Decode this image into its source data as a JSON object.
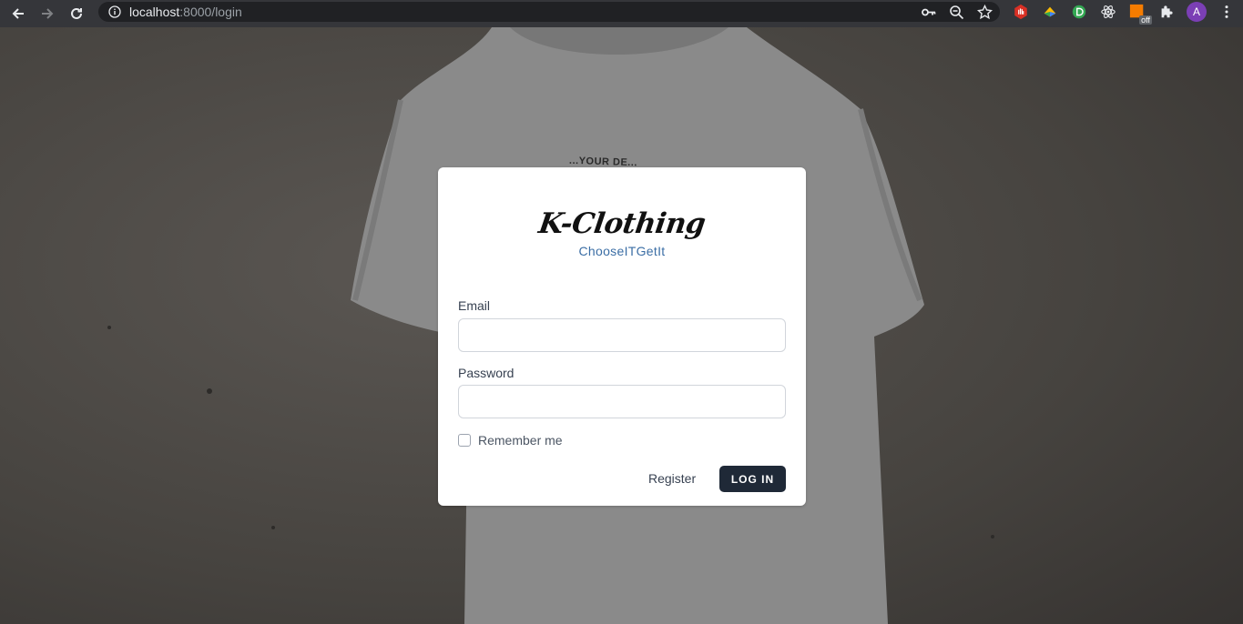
{
  "browser": {
    "url_host": "localhost",
    "url_path": ":8000/login",
    "profile_initial": "A",
    "extension_badge": "off"
  },
  "background": {
    "shirt_print": "...YOUR DE..."
  },
  "login": {
    "logo_text": "K-Clothing",
    "tagline": "ChooseITGetIt",
    "email_label": "Email",
    "email_value": "",
    "password_label": "Password",
    "password_value": "",
    "remember_label": "Remember me",
    "register_label": "Register",
    "login_button": "LOG IN"
  },
  "colors": {
    "browser_bar": "#35363a",
    "button_bg": "#1f2937",
    "tagline": "#3b6ea5"
  }
}
